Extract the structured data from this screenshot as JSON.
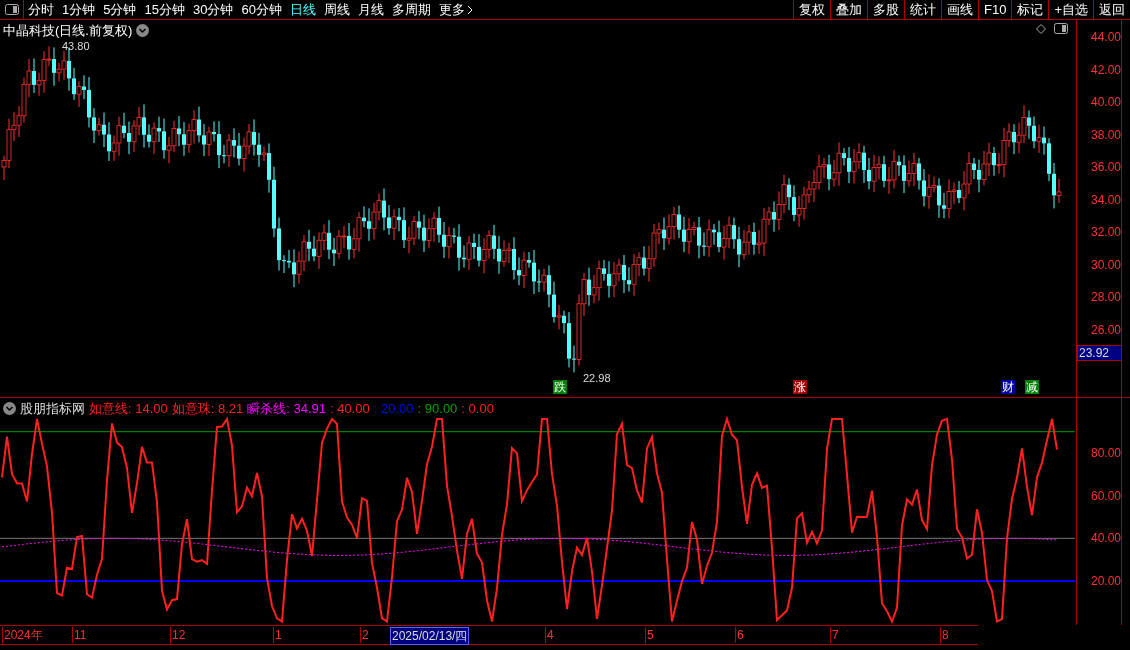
{
  "toolbar": {
    "periods": [
      {
        "label": "分时",
        "selected": false
      },
      {
        "label": "1分钟",
        "selected": false
      },
      {
        "label": "5分钟",
        "selected": false
      },
      {
        "label": "15分钟",
        "selected": false
      },
      {
        "label": "30分钟",
        "selected": false
      },
      {
        "label": "60分钟",
        "selected": false
      },
      {
        "label": "日线",
        "selected": true
      },
      {
        "label": "周线",
        "selected": false
      },
      {
        "label": "月线",
        "selected": false
      },
      {
        "label": "多周期",
        "selected": false
      }
    ],
    "more": "更多",
    "actions": [
      "复权",
      "叠加",
      "多股",
      "统计",
      "画线",
      "F10",
      "标记",
      "+自选",
      "返回"
    ]
  },
  "main_chart": {
    "title": "中晶科技(日线.前复权)",
    "high_label": "43.80",
    "low_label": "22.98",
    "y_ticks": [
      "44.00",
      "42.00",
      "40.00",
      "38.00",
      "36.00",
      "34.00",
      "32.00",
      "30.00",
      "28.00",
      "26.00"
    ],
    "price_tag": "23.92",
    "markers": [
      {
        "text": "跌",
        "color": "#008000"
      },
      {
        "text": "涨",
        "color": "#a00000"
      },
      {
        "text": "财",
        "color": "#0000a0"
      },
      {
        "text": "减",
        "color": "#008000"
      }
    ]
  },
  "indicator": {
    "name": "股朋指标网",
    "values": [
      {
        "text": "如意线: 14.00",
        "color": "#ff2020"
      },
      {
        "text": "如意珠: 8.21",
        "color": "#ff2020"
      },
      {
        "text": "瞬杀线: 34.91",
        "color": "#ff00ff"
      },
      {
        "text": ": 40.00",
        "color": "#ff2020"
      },
      {
        "text": ": 20.00",
        "color": "#0000ff"
      },
      {
        "text": ": 90.00",
        "color": "#00a000"
      },
      {
        "text": ": 0.00",
        "color": "#ff2020"
      }
    ],
    "y_ticks": [
      "80.00",
      "60.00",
      "40.00",
      "20.00"
    ]
  },
  "time_axis": {
    "labels": [
      "2024年",
      "11",
      "12",
      "1",
      "2",
      "4",
      "5",
      "6",
      "7",
      "8"
    ],
    "cursor_date": "2025/02/13/四"
  }
}
